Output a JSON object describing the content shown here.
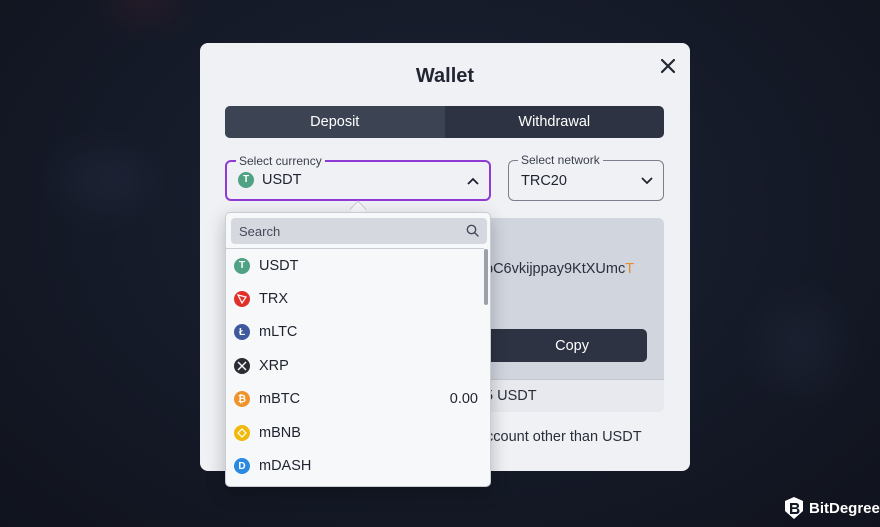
{
  "modal": {
    "title": "Wallet",
    "tabs": [
      {
        "label": "Deposit",
        "active": true
      },
      {
        "label": "Withdrawal",
        "active": false
      }
    ],
    "currency_field": {
      "label": "Select currency",
      "value": "USDT",
      "icon": "tether-coin-icon"
    },
    "network_field": {
      "label": "Select network",
      "value": "TRC20"
    },
    "address": {
      "visible_part": "bC6vkijppay9KtXUmc",
      "highlight_char": "T"
    },
    "copy_label": "Copy",
    "min_amount_text": "5 USDT",
    "warning_text": "ccount other than USDT"
  },
  "dropdown": {
    "search_placeholder": "Search",
    "items": [
      {
        "name": "USDT",
        "icon": "tether-icon",
        "color": "#4fa283",
        "balance": ""
      },
      {
        "name": "TRX",
        "icon": "tron-icon",
        "color": "#e0302a",
        "balance": ""
      },
      {
        "name": "mLTC",
        "icon": "litecoin-icon",
        "color": "#3e5a9c",
        "balance": ""
      },
      {
        "name": "XRP",
        "icon": "xrp-icon",
        "color": "#2a2d33",
        "balance": ""
      },
      {
        "name": "mBTC",
        "icon": "bitcoin-icon",
        "color": "#f0932a",
        "balance": "0.00"
      },
      {
        "name": "mBNB",
        "icon": "bnb-icon",
        "color": "#f0b90b",
        "balance": ""
      },
      {
        "name": "mDASH",
        "icon": "dash-icon",
        "color": "#2a8ae0",
        "balance": ""
      }
    ]
  },
  "brand": {
    "name": "BitDegree"
  },
  "colors": {
    "accent": "#8e3bd6",
    "dark": "#2d3342",
    "modal_bg": "#eff1f5"
  }
}
